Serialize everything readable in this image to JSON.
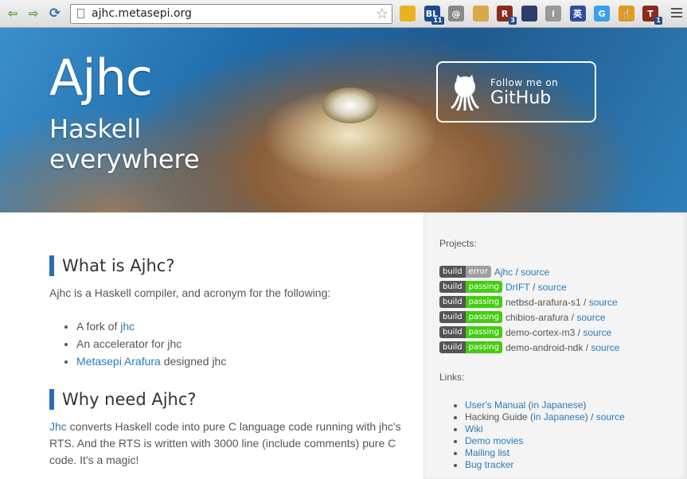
{
  "browser": {
    "url": "ajhc.metasepi.org",
    "extensions": [
      {
        "name": "cloud-extension-icon",
        "label": "",
        "color": "#e8b320"
      },
      {
        "name": "bl-extension-icon",
        "label": "BL",
        "badge": "11",
        "color": "#1c4c8c"
      },
      {
        "name": "clipboard-extension-icon",
        "label": "@",
        "color": "#888888"
      },
      {
        "name": "cookie-extension-icon",
        "label": "",
        "color": "#d9a84a"
      },
      {
        "name": "r-extension-icon",
        "label": "R",
        "badge": "3",
        "color": "#8a2b1b"
      },
      {
        "name": "book-extension-icon",
        "label": "",
        "color": "#2c3e6b"
      },
      {
        "name": "info-extension-icon",
        "label": "i",
        "color": "#999999"
      },
      {
        "name": "dictionary-extension-icon",
        "label": "英",
        "color": "#2d4ea0"
      },
      {
        "name": "g-extension-icon",
        "label": "G",
        "color": "#3aa0e8"
      },
      {
        "name": "fork-extension-icon",
        "label": "🍴",
        "color": "#e09a20"
      },
      {
        "name": "t-extension-icon",
        "label": "T",
        "badge": "1",
        "color": "#8a2b1b"
      }
    ]
  },
  "hero": {
    "title": "Ajhc",
    "tagline": "Haskell everywhere",
    "github_follow": "Follow me on",
    "github_name": "GitHub"
  },
  "main": {
    "section1": {
      "heading": "What is Ajhc?",
      "intro": "Ajhc is a Haskell compiler, and acronym for the following:",
      "item1_prefix": "A fork of ",
      "item1_link": "jhc",
      "item2": "An accelerator for jhc",
      "item3_link": "Metasepi Arafura",
      "item3_suffix": " designed jhc"
    },
    "section2": {
      "heading": "Why need Ajhc?",
      "link": "Jhc",
      "text": " converts Haskell code into pure C language code running with jhc's RTS. And the RTS is written with 3000 line (include comments) pure C code. It's a magic!"
    }
  },
  "sidebar": {
    "projects_label": "Projects:",
    "projects": [
      {
        "badge_left": "build",
        "status": "error",
        "status_color": "#9f9f9f",
        "name": "Ajhc",
        "name_link": true,
        "sep": " / ",
        "source": "source"
      },
      {
        "badge_left": "build",
        "status": "passing",
        "status_color": "#44cc11",
        "name": "DrIFT",
        "name_link": true,
        "sep": " / ",
        "source": "source"
      },
      {
        "badge_left": "build",
        "status": "passing",
        "status_color": "#44cc11",
        "name": "netbsd-arafura-s1",
        "name_link": false,
        "sep": " / ",
        "source": "source"
      },
      {
        "badge_left": "build",
        "status": "passing",
        "status_color": "#44cc11",
        "name": "chibios-arafura",
        "name_link": false,
        "sep": " / ",
        "source": "source"
      },
      {
        "badge_left": "build",
        "status": "passing",
        "status_color": "#44cc11",
        "name": "demo-cortex-m3",
        "name_link": false,
        "sep": " / ",
        "source": "source"
      },
      {
        "badge_left": "build",
        "status": "passing",
        "status_color": "#44cc11",
        "name": "demo-android-ndk",
        "name_link": false,
        "sep": " / ",
        "source": "source"
      }
    ],
    "links_label": "Links:",
    "links": {
      "manual": "User's Manual",
      "manual_jp": "in Japanese",
      "hacking": "Hacking Guide",
      "hacking_jp": "in Japanese",
      "hacking_source": "source",
      "wiki": "Wiki",
      "demo": "Demo movies",
      "mailing": "Mailing list",
      "bugs": "Bug tracker"
    }
  }
}
